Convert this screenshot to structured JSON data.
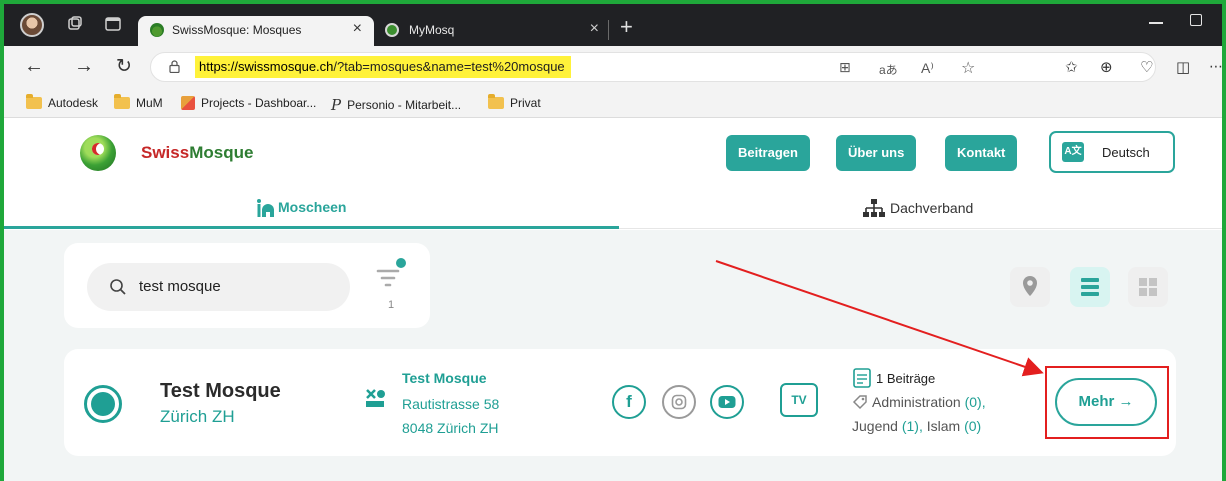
{
  "browser": {
    "tabs": [
      {
        "title": "SwissMosque: Mosques",
        "active": true
      },
      {
        "title": "MyMosq",
        "active": false
      }
    ],
    "url": "https://swissmosque.ch/?tab=mosques&name=test%20mosque",
    "url_host": "https://swissmosque.ch",
    "url_rest": "/?tab=mosques&name=test%20mosque",
    "bookmarks": [
      {
        "label": "Autodesk",
        "icon": "folder-icon"
      },
      {
        "label": "MuM",
        "icon": "folder-icon"
      },
      {
        "label": "Projects - Dashboar...",
        "icon": "jira-icon"
      },
      {
        "label": "Personio - Mitarbeit...",
        "icon": "personio-icon"
      },
      {
        "label": "Privat",
        "icon": "folder-icon"
      }
    ]
  },
  "site": {
    "brand_part1": "Swiss",
    "brand_part2": "Mosque",
    "nav": {
      "beitragen": "Beitragen",
      "ueber_uns": "Über uns",
      "kontakt": "Kontakt",
      "language": "Deutsch"
    },
    "tabs": {
      "moscheen": "Moscheen",
      "dachverband": "Dachverband"
    },
    "search": {
      "value": "test mosque",
      "filter_count": "1"
    },
    "result": {
      "name": "Test Mosque",
      "city": "Zürich ZH",
      "address_title": "Test Mosque",
      "street": "Rautistrasse 58",
      "zip_city": "8048 Zürich ZH",
      "tv_label": "TV",
      "beitraege": "1 Beiträge",
      "cat_admin_label": "Administration",
      "cat_admin_count": "(0),",
      "cat_jugend_label": "Jugend",
      "cat_jugend_count": "(1),",
      "cat_islam_label": "Islam",
      "cat_islam_count": "(0)",
      "mehr_label": "Mehr →"
    }
  },
  "colors": {
    "accent": "#2aa59b",
    "brand_red": "#c62828",
    "brand_green": "#2e7d32",
    "annotation": "#e31f1f",
    "frame": "#1fa83a"
  }
}
